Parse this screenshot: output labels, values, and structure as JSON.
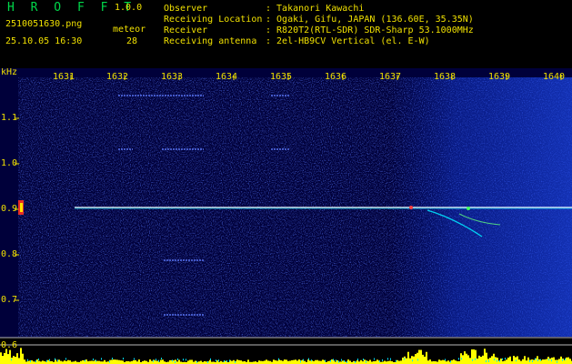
{
  "header": {
    "app_name": "H R O F F T",
    "version": "1.0.0",
    "filename": "2510051630.png",
    "mode": "meteor",
    "datetime": "25.10.05 16:30",
    "count": "28",
    "info": [
      {
        "key": "Observer",
        "value": ": Takanori Kawachi"
      },
      {
        "key": "Receiving Location",
        "value": ": Ogaki, Gifu, JAPAN (136.60E, 35.35N)"
      },
      {
        "key": "Receiver",
        "value": ": R820T2(RTL-SDR) SDR-Sharp 53.1000MHz"
      },
      {
        "key": "Receiving antenna",
        "value": ": 2el-HB9CV Vertical (el. E-W)"
      }
    ]
  },
  "spectrogram": {
    "y_unit": "kHz",
    "time_labels": [
      "1631",
      "1632",
      "1633",
      "1634",
      "1635",
      "1636",
      "1637",
      "1638",
      "1639",
      "1640"
    ],
    "freq_labels": [
      "1.1",
      "1.0",
      "0.9",
      "0.8",
      "0.7",
      "0.6"
    ],
    "colors": {
      "label": "#f0e000",
      "background": "#00003a",
      "signal": "#ffffff",
      "level": "#ffff00",
      "trace": "#00e5ff"
    }
  }
}
